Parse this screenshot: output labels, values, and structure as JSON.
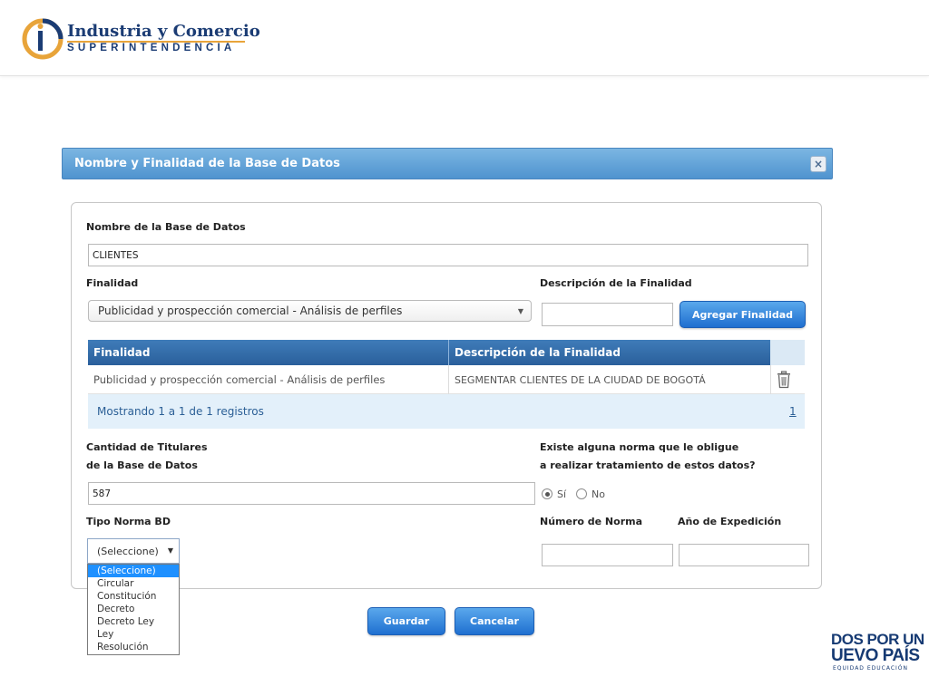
{
  "header": {
    "logo_title": "Industria y Comercio",
    "logo_subtitle": "SUPERINTENDENCIA"
  },
  "brand": {
    "line1": "DOS POR UN",
    "line2": "UEVO PAÍS",
    "line3": "EQUIDAD  EDUCACIÓN"
  },
  "dialog": {
    "title": "Nombre y Finalidad de la Base de Datos",
    "close_label": "×",
    "nombre_label": "Nombre de la Base de Datos",
    "nombre_value": "CLIENTES",
    "finalidad_label": "Finalidad",
    "finalidad_selected": "Publicidad y prospección comercial - Análisis de perfiles",
    "descripcion_label": "Descripción de la Finalidad",
    "descripcion_value": "",
    "agregar_button": "Agregar Finalidad",
    "table": {
      "headers": [
        "Finalidad",
        "Descripción de la Finalidad"
      ],
      "rows": [
        [
          "Publicidad y prospección comercial - Análisis de perfiles",
          "SEGMENTAR CLIENTES DE LA CIUDAD DE BOGOTÁ"
        ]
      ],
      "footer_text": "Mostrando 1 a 1 de 1 registros",
      "page": "1"
    },
    "cantidad_label_1": "Cantidad de Titulares",
    "cantidad_label_2": "de la Base de Datos",
    "cantidad_value": "587",
    "norma_q_1": "Existe alguna norma que le obligue",
    "norma_q_2": "a realizar tratamiento de estos datos?",
    "radio_si": "Sí",
    "radio_no": "No",
    "tipo_norma_label": "Tipo Norma BD",
    "tipo_norma_selected": "(Seleccione)",
    "tipo_norma_options": [
      "(Seleccione)",
      "Circular",
      "Constitución",
      "Decreto",
      "Decreto Ley",
      "Ley",
      "Resolución"
    ],
    "numero_norma_label": "Número de Norma",
    "anio_label": "Año de Expedición",
    "numero_norma_value": "",
    "anio_value": "",
    "guardar_button": "Guardar",
    "cancelar_button": "Cancelar"
  },
  "colors": {
    "header_blue": "#4f93cf",
    "table_head": "#2a5f9b",
    "button_blue": "#1f6fd0",
    "brand_navy": "#1b3c74",
    "brand_gold": "#e8a43a"
  }
}
